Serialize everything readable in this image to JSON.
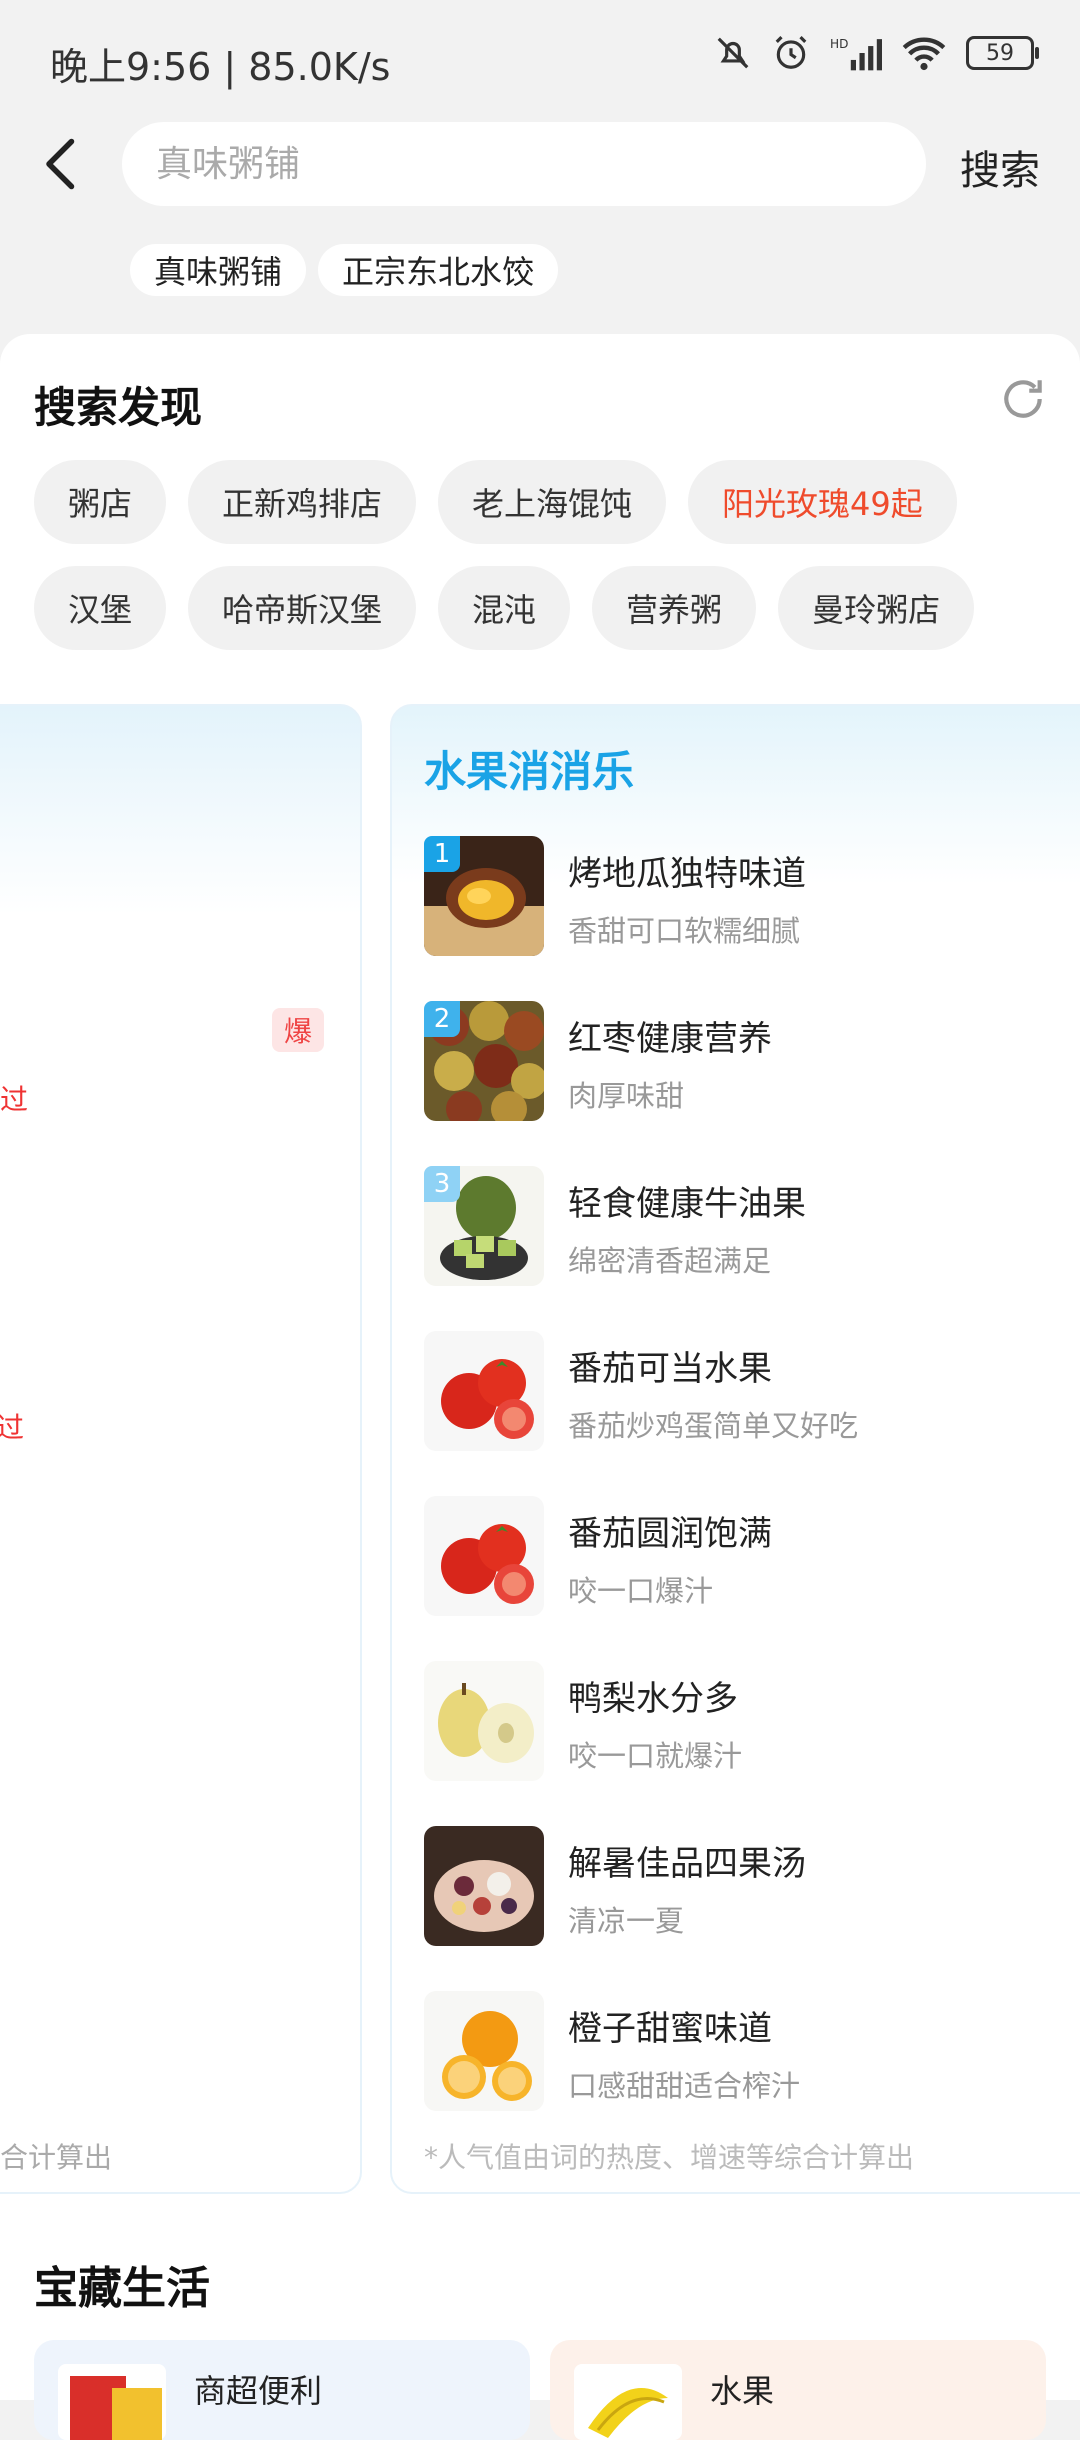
{
  "status_bar": {
    "time_speed": "晚上9:56 | 85.0K/s",
    "battery": "59"
  },
  "search": {
    "placeholder": "真味粥铺",
    "button_label": "搜索",
    "history": [
      "真味粥铺",
      "正宗东北水饺"
    ]
  },
  "discover": {
    "title": "搜索发现",
    "row1": [
      {
        "label": "粥店",
        "hot": false
      },
      {
        "label": "正新鸡排店",
        "hot": false
      },
      {
        "label": "老上海馄饨",
        "hot": false
      },
      {
        "label": "阳光玫瑰49起",
        "hot": true
      }
    ],
    "row2": [
      {
        "label": "汉堡",
        "hot": false
      },
      {
        "label": "哈帝斯汉堡",
        "hot": false
      },
      {
        "label": "混沌",
        "hot": false
      },
      {
        "label": "营养粥",
        "hot": false
      },
      {
        "label": "曼玲粥店",
        "hot": false
      }
    ],
    "accent": "#ef4b2c"
  },
  "left_panel": {
    "badge": "爆",
    "frag1": "过",
    "frag2": "过",
    "footer": "合计算出"
  },
  "ranking": {
    "title": "水果消消乐",
    "title_color": "#1aa3e6",
    "items": [
      {
        "rank": "1",
        "name": "烤地瓜独特味道",
        "desc": "香甜可口软糯细腻",
        "icon": "sweet-potato"
      },
      {
        "rank": "2",
        "name": "红枣健康营养",
        "desc": "肉厚味甜",
        "icon": "jujube"
      },
      {
        "rank": "3",
        "name": "轻食健康牛油果",
        "desc": "绵密清香超满足",
        "icon": "avocado"
      },
      {
        "rank": "",
        "name": "番茄可当水果",
        "desc": "番茄炒鸡蛋简单又好吃",
        "icon": "tomato"
      },
      {
        "rank": "",
        "name": "番茄圆润饱满",
        "desc": "咬一口爆汁",
        "icon": "tomato"
      },
      {
        "rank": "",
        "name": "鸭梨水分多",
        "desc": "咬一口就爆汁",
        "icon": "pear"
      },
      {
        "rank": "",
        "name": "解暑佳品四果汤",
        "desc": "清凉一夏",
        "icon": "fruit-soup"
      },
      {
        "rank": "",
        "name": "橙子甜蜜味道",
        "desc": "口感甜甜适合榨汁",
        "icon": "orange"
      }
    ],
    "footer": "*人气值由词的热度、增速等综合计算出"
  },
  "treasure": {
    "title": "宝藏生活",
    "cards": [
      {
        "label": "商超便利",
        "icon": "grocery-bag"
      },
      {
        "label": "水果",
        "icon": "banana"
      }
    ]
  }
}
